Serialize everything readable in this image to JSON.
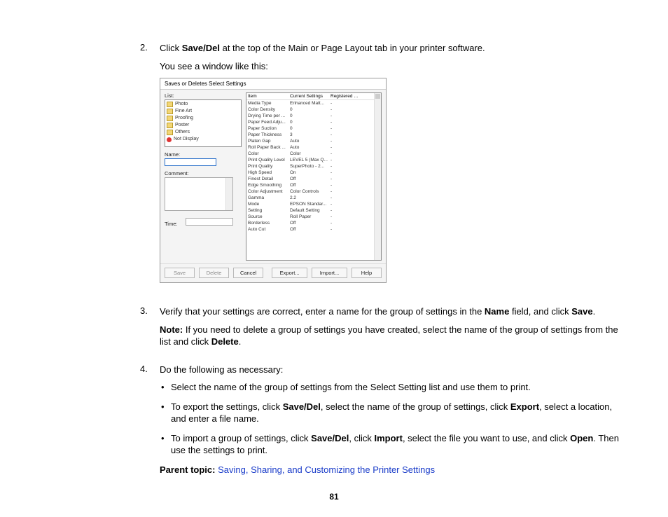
{
  "steps": {
    "s2num": "2.",
    "s2a_pre": "Click ",
    "s2a_bold": "Save/Del",
    "s2a_post": " at the top of the Main or Page Layout tab in your printer software.",
    "s2b": "You see a window like this:",
    "s3num": "3.",
    "s3a_pre": "Verify that your settings are correct, enter a name for the group of settings in the ",
    "s3a_bold1": "Name",
    "s3a_mid": " field, and click ",
    "s3a_bold2": "Save",
    "s3a_post": ".",
    "s3note_label": "Note:",
    "s3note_body1": " If you need to delete a group of settings you have created, select the name of the group of settings from the list and click ",
    "s3note_bold": "Delete",
    "s3note_post": ".",
    "s4num": "4.",
    "s4a": "Do the following as necessary:",
    "s4b1": "Select the name of the group of settings from the Select Setting list and use them to print.",
    "s4b2_pre": "To export the settings, click ",
    "s4b2_b1": "Save/Del",
    "s4b2_mid1": ", select the name of the group of settings, click ",
    "s4b2_b2": "Export",
    "s4b2_post": ", select a location, and enter a file name.",
    "s4b3_pre": "To import a group of settings, click ",
    "s4b3_b1": "Save/Del",
    "s4b3_mid1": ", click ",
    "s4b3_b2": "Import",
    "s4b3_mid2": ", select the file you want to use, and click ",
    "s4b3_b3": "Open",
    "s4b3_post": ". Then use the settings to print."
  },
  "parent": {
    "label": "Parent topic:",
    "link": "Saving, Sharing, and Customizing the Printer Settings"
  },
  "pagenum": "81",
  "dialog": {
    "title": "Saves or Deletes Select Settings",
    "list_label": "List:",
    "list_items": [
      "Photo",
      "Fine Art",
      "Proofing",
      "Poster",
      "Others",
      "Not Display"
    ],
    "name_label": "Name:",
    "comment_label": "Comment:",
    "time_label": "Time:",
    "grid_headers": [
      "Item",
      "Current Settings",
      "Registered Sett..."
    ],
    "grid_rows": [
      [
        "Media Type",
        "Enhanced Matt...",
        "-"
      ],
      [
        "Color Density",
        "0",
        "-"
      ],
      [
        "Drying Time per ...",
        "0",
        "-"
      ],
      [
        "Paper Feed Adju...",
        "0",
        "-"
      ],
      [
        "Paper Suction",
        "0",
        "-"
      ],
      [
        "Paper Thickness",
        "3",
        "-"
      ],
      [
        "Platen Gap",
        "Auto",
        "-"
      ],
      [
        "Roll Paper Back ...",
        "Auto",
        "-"
      ],
      [
        "Color",
        "Color",
        "-"
      ],
      [
        "Print Quality Level",
        "LEVEL 5 (Max Q...",
        "-"
      ],
      [
        "Print Quality",
        "SuperPhoto - 2...",
        "-"
      ],
      [
        "High Speed",
        "On",
        "-"
      ],
      [
        "Finest Detail",
        "Off",
        "-"
      ],
      [
        "Edge Smoothing",
        "Off",
        "-"
      ],
      [
        "Color Adjustment",
        "Color Controls",
        "-"
      ],
      [
        "Gamma",
        "2.2",
        "-"
      ],
      [
        "Mode",
        "EPSON Standar...",
        "-"
      ],
      [
        "Setting",
        "Default Setting",
        "-"
      ],
      [
        "Source",
        "Roll Paper",
        "-"
      ],
      [
        "Borderless",
        "Off",
        "-"
      ],
      [
        "Auto Cut",
        "Off",
        "-"
      ]
    ],
    "buttons": {
      "save": "Save",
      "delete": "Delete",
      "cancel": "Cancel",
      "export": "Export...",
      "import": "Import...",
      "help": "Help"
    }
  }
}
